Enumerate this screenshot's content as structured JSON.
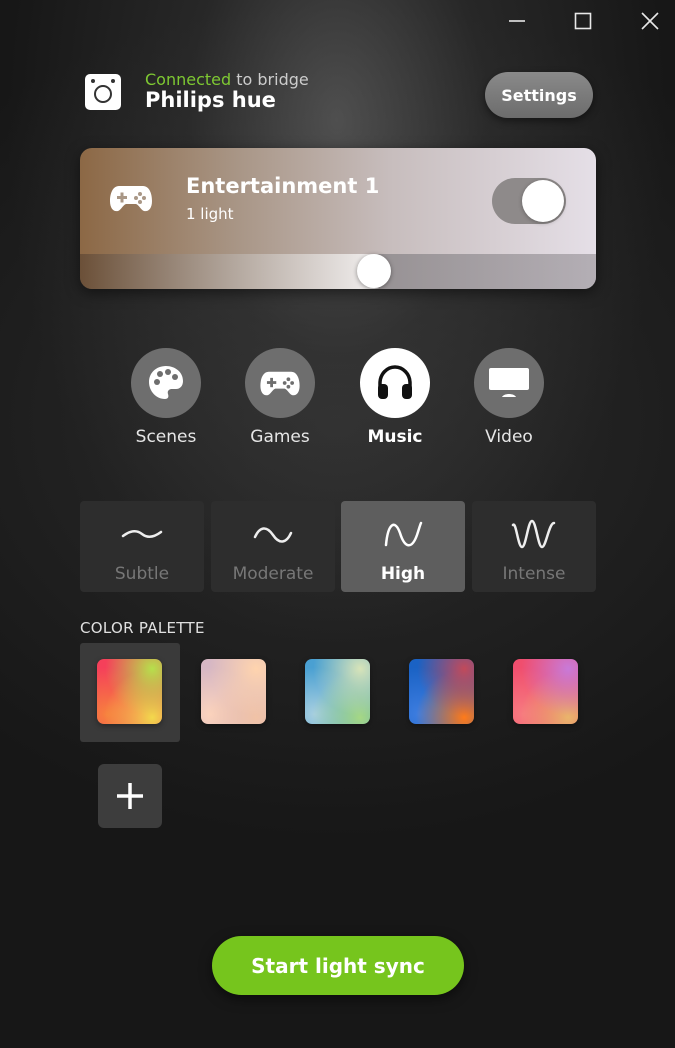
{
  "window": {
    "controls": [
      "minimize-icon",
      "maximize-icon",
      "close-icon"
    ]
  },
  "bridge": {
    "status_word": "Connected",
    "status_rest": " to bridge",
    "name": "Philips hue",
    "status_color": "#7ec832"
  },
  "header": {
    "settings_label": "Settings"
  },
  "entertainment": {
    "title": "Entertainment 1",
    "subtitle": "1 light",
    "enabled": true,
    "brightness_fraction": 0.57
  },
  "modes": [
    {
      "label": "Scenes",
      "icon": "palette-icon",
      "active": false
    },
    {
      "label": "Games",
      "icon": "gamepad-icon",
      "active": false
    },
    {
      "label": "Music",
      "icon": "headphones-icon",
      "active": true
    },
    {
      "label": "Video",
      "icon": "monitor-icon",
      "active": false
    }
  ],
  "intensity": [
    {
      "label": "Subtle",
      "icon": "wave-subtle-icon",
      "active": false
    },
    {
      "label": "Moderate",
      "icon": "wave-moderate-icon",
      "active": false
    },
    {
      "label": "High",
      "icon": "wave-high-icon",
      "active": true
    },
    {
      "label": "Intense",
      "icon": "wave-intense-icon",
      "active": false
    }
  ],
  "palette": {
    "title": "COLOR PALETTE",
    "selected_index": 0,
    "swatches": [
      {
        "colors": [
          "#f5405a",
          "#f7803e",
          "#b6e04c",
          "#f2d94c"
        ]
      },
      {
        "colors": [
          "#d6b7c4",
          "#fbd3bd",
          "#ffd4ae",
          "#f1c3a6"
        ]
      },
      {
        "colors": [
          "#4aa0d2",
          "#a8cfe0",
          "#d8e4b8",
          "#a6d884"
        ]
      },
      {
        "colors": [
          "#1a62c4",
          "#3d7de0",
          "#c24a5a",
          "#ff7a1a"
        ]
      },
      {
        "colors": [
          "#f04e6e",
          "#f77a80",
          "#c87ad8",
          "#e9b56c"
        ]
      }
    ],
    "add_icon": "plus-icon"
  },
  "actions": {
    "start_label": "Start light sync",
    "start_color": "#76c51d"
  }
}
